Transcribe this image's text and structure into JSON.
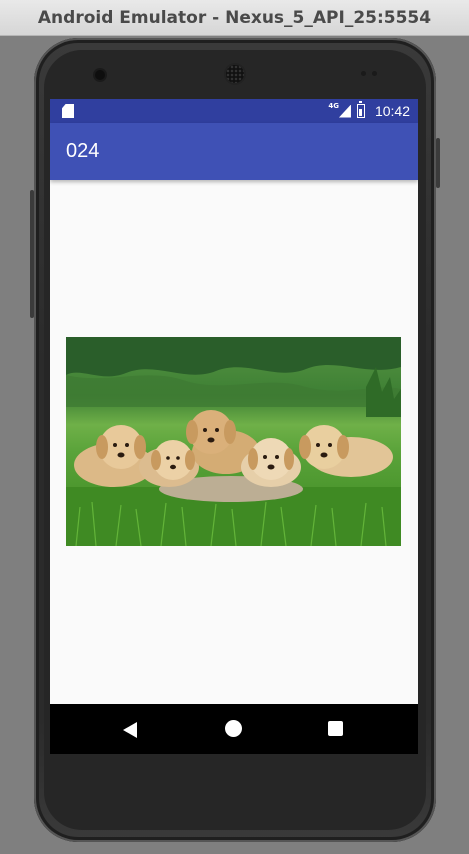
{
  "window": {
    "title": "Android Emulator - Nexus_5_API_25:5554"
  },
  "statusbar": {
    "network_label": "4G",
    "time": "10:42",
    "icons": [
      "sd-card-icon",
      "signal-icon",
      "battery-icon"
    ]
  },
  "appbar": {
    "title": "024"
  },
  "image": {
    "subject": "puppies-photo"
  },
  "navbar": {
    "icons": [
      "back-icon",
      "home-icon",
      "recents-icon"
    ]
  },
  "colors": {
    "statusbar": "#303f9f",
    "appbar": "#3f51b5",
    "screen_bg": "#fafafa",
    "navbar": "#000000"
  }
}
